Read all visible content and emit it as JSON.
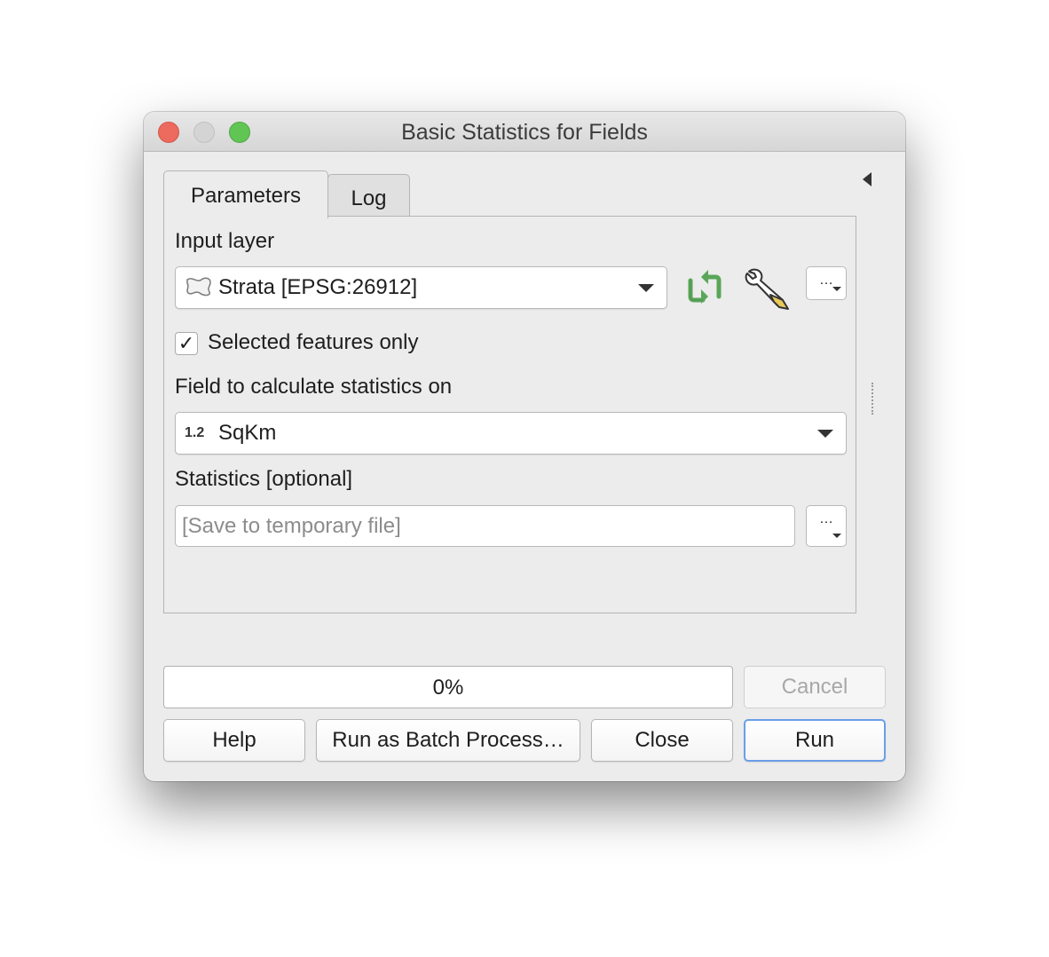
{
  "window": {
    "title": "Basic Statistics for Fields"
  },
  "tabs": [
    {
      "label": "Parameters"
    },
    {
      "label": "Log"
    }
  ],
  "params": {
    "input_layer_label": "Input layer",
    "input_layer_value": "Strata [EPSG:26912]",
    "selected_only_label": "Selected features only",
    "selected_only_checked": "✓",
    "field_label": "Field to calculate statistics on",
    "field_type_badge": "1.2",
    "field_value": "SqKm",
    "statistics_label": "Statistics [optional]",
    "statistics_placeholder": "[Save to temporary file]",
    "ellipsis": "…"
  },
  "progress": {
    "text": "0%",
    "value": 0
  },
  "buttons": {
    "cancel": "Cancel",
    "help": "Help",
    "batch": "Run as Batch Process…",
    "close": "Close",
    "run": "Run"
  },
  "icons": {
    "iterate": "iterate-icon",
    "wrench": "wrench-icon",
    "layer": "polygon-layer-icon"
  },
  "colors": {
    "accent_default_button": "#6a9ee8",
    "iterate_green": "#5aa65a"
  }
}
